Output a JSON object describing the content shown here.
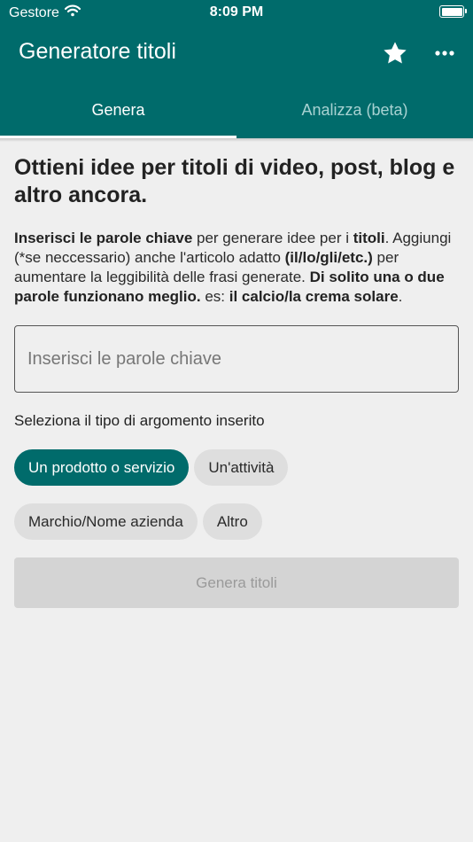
{
  "status_bar": {
    "carrier": "Gestore",
    "time": "8:09 PM"
  },
  "app_bar": {
    "title": "Generatore titoli",
    "icons": [
      "star-icon",
      "more-icon"
    ]
  },
  "tabs": [
    {
      "label": "Genera",
      "active": true
    },
    {
      "label": "Analizza (beta)",
      "active": false
    }
  ],
  "main": {
    "headline": "Ottieni idee per titoli di video, post, blog e altro ancora.",
    "description": {
      "s1_bold": "Inserisci le parole chiave",
      "s2": " per generare idee per i ",
      "s3_bold": "titoli",
      "s4": ". Aggiungi (*se neccessario) anche l'articolo adatto ",
      "s5_bold": "(il/lo/gli/etc.)",
      "s6": " per aumentare la leggibilità delle frasi generate. ",
      "s7_bold": "Di solito una o due parole funzionano meglio.",
      "s8": " es: ",
      "s9_bold": "il calcio/la crema solare",
      "s10": "."
    },
    "keyword_input": {
      "placeholder": "Inserisci le parole chiave",
      "value": ""
    },
    "select_label": "Seleziona il tipo di argomento inserito",
    "chips": [
      {
        "label": "Un prodotto o servizio",
        "selected": true
      },
      {
        "label": "Un'attività",
        "selected": false
      },
      {
        "label": "Marchio/Nome azienda",
        "selected": false
      },
      {
        "label": "Altro",
        "selected": false
      }
    ],
    "generate_button": "Genera titoli"
  },
  "colors": {
    "primary": "#006b6b",
    "background": "#efefef",
    "chip": "#dedede",
    "disabled_button": "#d4d4d4"
  }
}
